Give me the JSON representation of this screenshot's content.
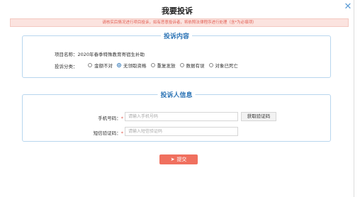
{
  "dialog": {
    "title": "我要投诉",
    "close_glyph": "✕"
  },
  "notice": "请核实后情况进行项目投诉，如有恶意投诉者，将依照法律程序进行处理（含*为必填项）",
  "complaint_section": {
    "legend": "投诉内容",
    "project_label": "项目名称：",
    "project_value": "2020年春季特殊教育寄宿生补助",
    "category_label": "投诉分类：",
    "options": [
      "金额不对",
      "无领取资格",
      "重复发放",
      "数据有误",
      "对象已死亡"
    ],
    "selected_index": 1
  },
  "complainant_section": {
    "legend": "投诉人信息",
    "phone_label": "手机号码：",
    "phone_placeholder": "请输入手机号码",
    "get_code_label": "获取验证码",
    "code_label": "短信验证码：",
    "code_placeholder": "请输入短信验证码",
    "required_mark": "*"
  },
  "submit_label": "提交",
  "colors": {
    "accent_blue": "#2e75b6",
    "submit_red": "#f0705f",
    "notice_text": "#e05a4e"
  }
}
